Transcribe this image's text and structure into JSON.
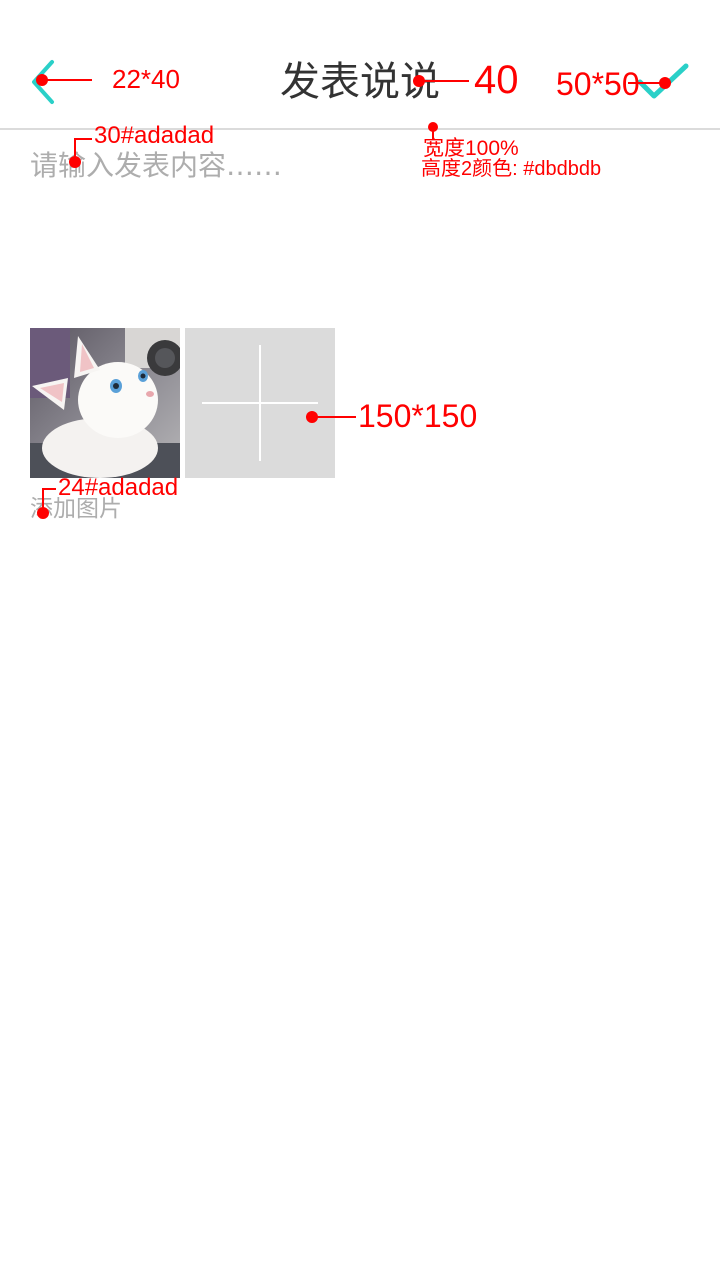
{
  "header": {
    "title": "发表说说",
    "back_icon": "arrow-left-icon",
    "confirm_icon": "check-icon",
    "accent_color": "#2ad0c8"
  },
  "divider": {
    "color": "#dbdbdb"
  },
  "content": {
    "placeholder": "请输入发表内容……",
    "value": ""
  },
  "photos": {
    "items": [
      {
        "alt": "white kitten photo"
      }
    ],
    "add_button_icon": "plus-icon",
    "add_label": "添加图片"
  },
  "annotations": {
    "back_size": "22*40",
    "title_size": "40",
    "confirm_size": "50*50",
    "input_font": "30#adadad",
    "divider_width": "宽度100%",
    "divider_spec": "高度2颜色: #dbdbdb",
    "photo_size": "150*150",
    "label_font": "24#adadad",
    "color": "#ff0000"
  }
}
